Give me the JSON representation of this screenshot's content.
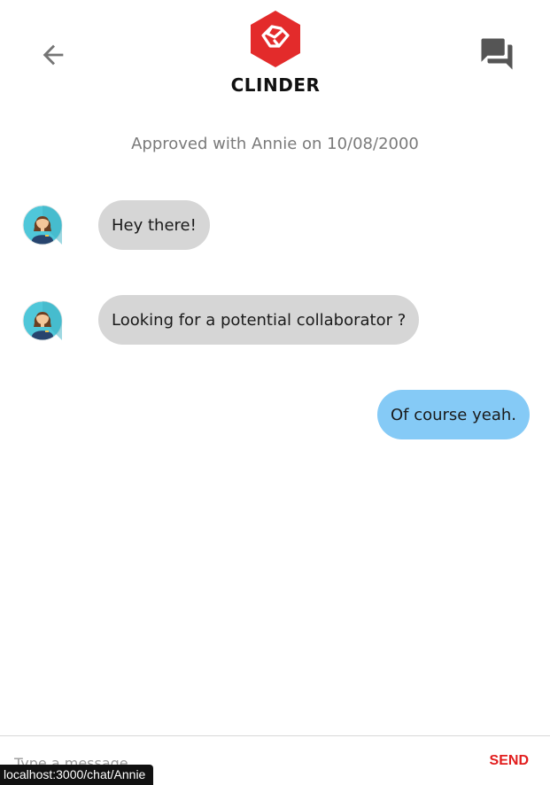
{
  "header": {
    "logo_text": "CLINDER",
    "back_icon": "arrow-left-icon",
    "chat_icon": "forum-icon",
    "brand_color": "#e32b2b"
  },
  "match_note": "Approved with Annie on 10/08/2000",
  "messages": [
    {
      "sender": "Annie",
      "direction": "received",
      "text": "Hey there!"
    },
    {
      "sender": "Annie",
      "direction": "received",
      "text": "Looking for a potential collaborator ?"
    },
    {
      "sender": "me",
      "direction": "sent",
      "text": "Of course yeah."
    }
  ],
  "composer": {
    "placeholder": "Type a message...",
    "value": "",
    "send_label": "SEND",
    "send_color": "#e21d1d"
  },
  "status_bar": {
    "url": "localhost:3000/chat/Annie"
  },
  "colors": {
    "received_bubble": "#d6d6d6",
    "sent_bubble": "#85caf6"
  }
}
